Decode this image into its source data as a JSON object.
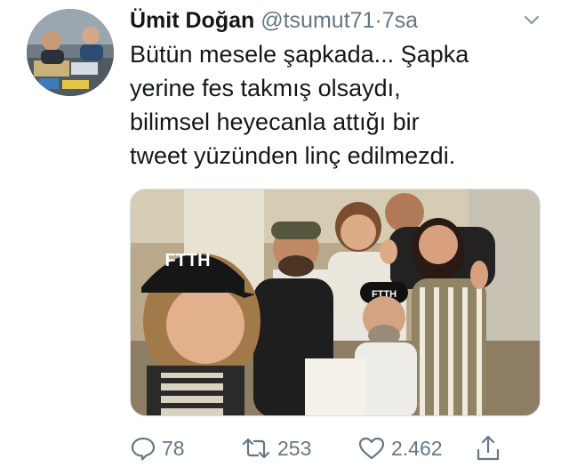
{
  "tweet": {
    "author_name": "Ümit Doğan",
    "handle": "@tsumut71",
    "separator": "·",
    "time": "7sa",
    "text_lines": [
      "Bütün mesele şapkada... Şapka",
      "yerine fes takmış olsaydı,",
      "bilimsel heyecanla attığı bir",
      "tweet yüzünden linç edilmezdi."
    ],
    "media": {
      "cap_text_1": "FTTH",
      "cap_text_2": "FTTH"
    },
    "icons": {
      "more": "chevron-down-icon",
      "reply": "reply-icon",
      "retweet": "retweet-icon",
      "like": "heart-icon",
      "share": "share-icon"
    }
  },
  "actions": {
    "reply_count": "78",
    "retweet_count": "253",
    "like_count": "2.462"
  },
  "colors": {
    "text": "#14171a",
    "secondary": "#657786"
  }
}
